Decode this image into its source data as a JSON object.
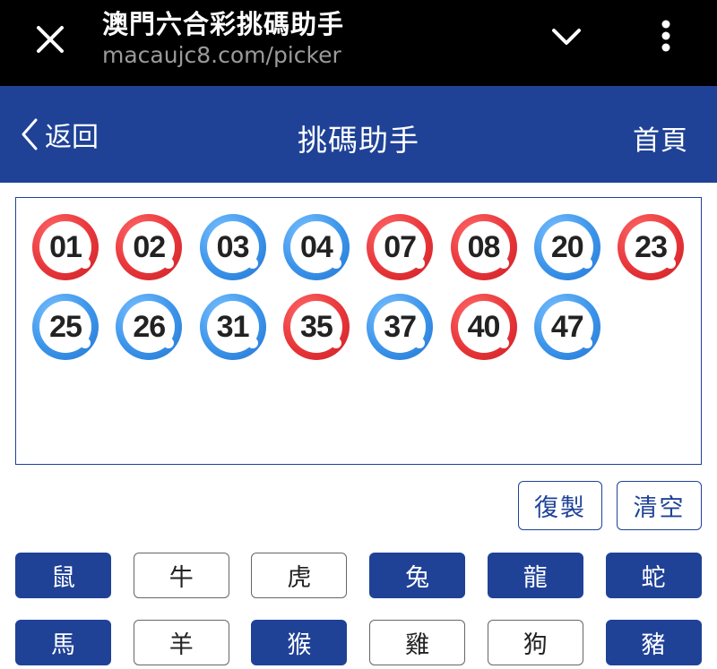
{
  "browser": {
    "title": "澳門六合彩挑碼助手",
    "url": "macaujc8.com/picker"
  },
  "header": {
    "back_label": "返回",
    "title": "挑碼助手",
    "home_label": "首頁"
  },
  "selected_numbers": [
    {
      "number": "01",
      "color": "red"
    },
    {
      "number": "02",
      "color": "red"
    },
    {
      "number": "03",
      "color": "blue"
    },
    {
      "number": "04",
      "color": "blue"
    },
    {
      "number": "07",
      "color": "red"
    },
    {
      "number": "08",
      "color": "red"
    },
    {
      "number": "20",
      "color": "blue"
    },
    {
      "number": "23",
      "color": "red"
    },
    {
      "number": "25",
      "color": "blue"
    },
    {
      "number": "26",
      "color": "blue"
    },
    {
      "number": "31",
      "color": "blue"
    },
    {
      "number": "35",
      "color": "red"
    },
    {
      "number": "37",
      "color": "blue"
    },
    {
      "number": "40",
      "color": "red"
    },
    {
      "number": "47",
      "color": "blue"
    }
  ],
  "actions": {
    "copy_label": "復製",
    "clear_label": "清空"
  },
  "zodiacs": [
    {
      "label": "鼠",
      "selected": true
    },
    {
      "label": "牛",
      "selected": false
    },
    {
      "label": "虎",
      "selected": false
    },
    {
      "label": "兔",
      "selected": true
    },
    {
      "label": "龍",
      "selected": true
    },
    {
      "label": "蛇",
      "selected": true
    },
    {
      "label": "馬",
      "selected": true
    },
    {
      "label": "羊",
      "selected": false
    },
    {
      "label": "猴",
      "selected": true
    },
    {
      "label": "雞",
      "selected": false
    },
    {
      "label": "狗",
      "selected": false
    },
    {
      "label": "豬",
      "selected": true
    }
  ],
  "colors": {
    "primary": "#1f4297",
    "ball_red": "#e8363a",
    "ball_blue": "#3b94ea"
  }
}
